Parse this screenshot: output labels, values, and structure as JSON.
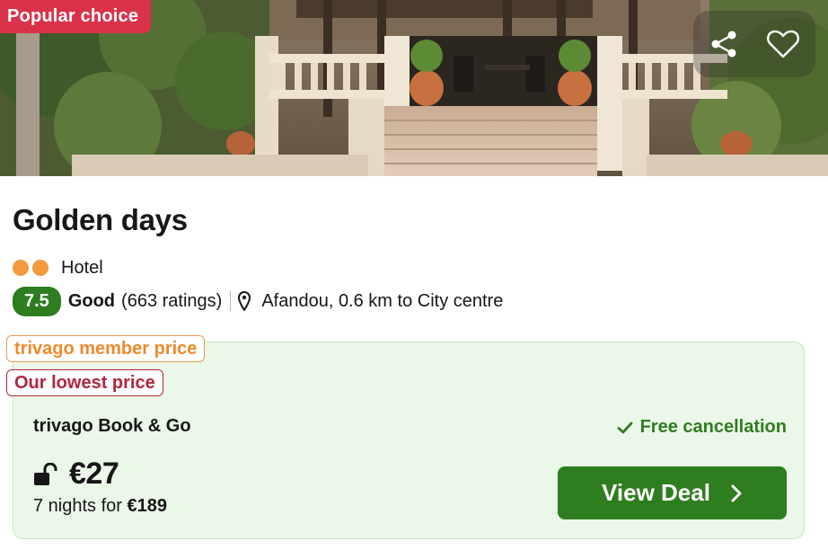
{
  "hero": {
    "badge": "Popular choice",
    "share_icon": "share-icon",
    "favorite_icon": "heart-icon"
  },
  "hotel": {
    "name": "Golden days",
    "stars": 2,
    "type": "Hotel",
    "score": "7.5",
    "rating_word": "Good",
    "rating_count": "(663 ratings)",
    "location": "Afandou, 0.6 km to City centre"
  },
  "deal": {
    "member_tag": "trivago member price",
    "lowest_tag": "Our lowest price",
    "provider": "trivago Book & Go",
    "free_cancellation": "Free cancellation",
    "price": "€27",
    "total_prefix": "7 nights for ",
    "total_price": "€189",
    "cta_label": "View Deal"
  },
  "colors": {
    "badge_red": "#d9324a",
    "brand_green": "#2e7d1f",
    "member_orange": "#ee8a2c",
    "lowest_red": "#b3263e",
    "deal_bg": "#ebf7e8",
    "star_dot": "#f29a3d"
  }
}
